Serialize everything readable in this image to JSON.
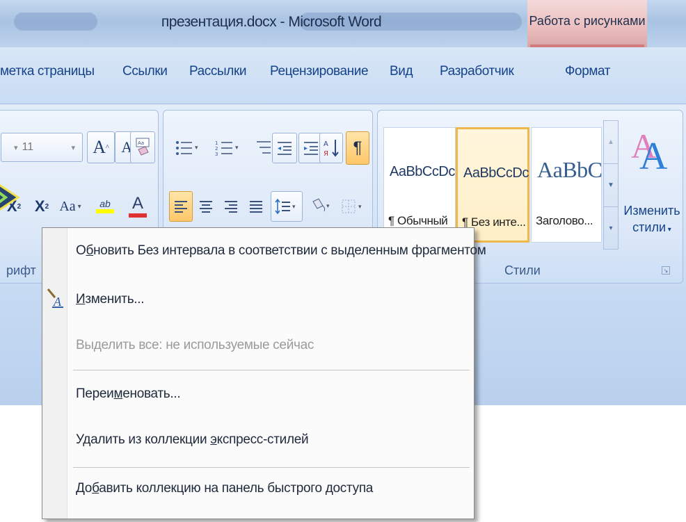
{
  "titlebar": {
    "title": "презентация.docx - Microsoft Word",
    "context_tab_header": "Работа с рисунками"
  },
  "tabs": [
    {
      "label": "метка страницы"
    },
    {
      "label": "Ссылки"
    },
    {
      "label": "Рассылки"
    },
    {
      "label": "Рецензирование"
    },
    {
      "label": "Вид"
    },
    {
      "label": "Разработчик"
    },
    {
      "label": "Формат"
    }
  ],
  "font_group": {
    "size_value": "11",
    "label": "рифт",
    "grow_font": "A",
    "shrink_font": "A",
    "subscript": "X",
    "superscript": "X",
    "change_case": "Aa",
    "highlight": "ab",
    "font_color": "A"
  },
  "paragraph_group": {
    "pilcrow": "¶"
  },
  "styles_group": {
    "label": "Стили",
    "styles": [
      {
        "sample": "AaBbCcDc",
        "caption": "¶ Обычный"
      },
      {
        "sample": "AaBbCcDc",
        "caption": "¶ Без инте..."
      },
      {
        "sample": "AaBbC",
        "caption": "Заголово..."
      }
    ],
    "change_styles": {
      "line1": "Изменить",
      "line2": "стили"
    }
  },
  "context_menu": {
    "items": [
      {
        "label_pre": "О",
        "label_ul": "б",
        "label_post": "новить Без интервала в соответствии с выделенным фрагментом"
      },
      {
        "label_pre": "",
        "label_ul": "И",
        "label_post": "зменить..."
      },
      {
        "label": "Выделить все: не используемые сейчас"
      },
      {
        "label_pre": "Переи",
        "label_ul": "м",
        "label_post": "еновать..."
      },
      {
        "label_pre": "Удалить из коллекции ",
        "label_ul": "э",
        "label_post": "кспресс-стилей"
      },
      {
        "label_pre": "До",
        "label_ul": "б",
        "label_post": "авить коллекцию на панель быстрого доступа"
      }
    ]
  },
  "colors": {
    "tab_text": "#15428b",
    "context_tab_accent": "#d27b7b",
    "selected_style_border": "#f0b84a",
    "font_color_bar": "#e03030",
    "highlight_bar": "#ffff00"
  }
}
